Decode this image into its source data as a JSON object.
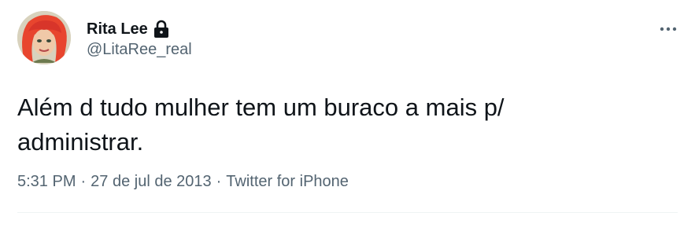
{
  "author": {
    "display_name": "Rita Lee",
    "handle": "@LitaRee_real",
    "protected_icon": "lock-icon",
    "avatar_icon": "avatar-image"
  },
  "menu": {
    "icon": "more-horizontal-icon"
  },
  "tweet": {
    "text": "Além d tudo mulher tem um buraco a mais p/\nadministrar."
  },
  "meta": {
    "time": "5:31 PM",
    "separator": "·",
    "date": "27 de jul de 2013",
    "source": "Twitter for iPhone"
  },
  "colors": {
    "text_primary": "#0f1419",
    "text_secondary": "#536471",
    "divider": "#eff3f4",
    "avatar_hair": "#e8452e"
  }
}
